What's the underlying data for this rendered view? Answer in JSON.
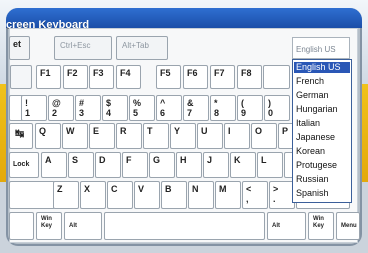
{
  "window": {
    "title": "creen Keyboard"
  },
  "toolbar": {
    "partial_label": "et",
    "ctrl_esc": "Ctrl+Esc",
    "alt_tab": "Alt+Tab"
  },
  "language": {
    "selected": "English US",
    "options": [
      "English US",
      "French",
      "German",
      "Hungarian",
      "Italian",
      "Japanese",
      "Korean",
      "Protugese",
      "Russian",
      "Spanish"
    ]
  },
  "rows": {
    "fkeys": [
      "F1",
      "F2",
      "F3",
      "F4",
      "F5",
      "F6",
      "F7",
      "F8"
    ],
    "numbers": [
      {
        "shift": "!",
        "base": "1"
      },
      {
        "shift": "@",
        "base": "2"
      },
      {
        "shift": "#",
        "base": "3"
      },
      {
        "shift": "$",
        "base": "4"
      },
      {
        "shift": "%",
        "base": "5"
      },
      {
        "shift": "^",
        "base": "6"
      },
      {
        "shift": "&",
        "base": "7"
      },
      {
        "shift": "*",
        "base": "8"
      },
      {
        "shift": "(",
        "base": "9"
      },
      {
        "shift": ")",
        "base": "0"
      }
    ],
    "qwerty": [
      "Q",
      "W",
      "E",
      "R",
      "T",
      "Y",
      "U",
      "I",
      "O",
      "P"
    ],
    "home": [
      "A",
      "S",
      "D",
      "F",
      "G",
      "H",
      "J",
      "K",
      "L"
    ],
    "bottom": [
      "Z",
      "X",
      "C",
      "V",
      "B",
      "N",
      "M"
    ],
    "bottom_punct": [
      {
        "shift": "<",
        "base": ","
      },
      {
        "shift": ">",
        "base": "."
      }
    ]
  },
  "special": {
    "tab_glyph": "↹",
    "caps_label": "Lock",
    "win_key": "Win Key",
    "alt": "Alt",
    "alt_right": "Alt",
    "win_key_right": "Win Key",
    "menu": "Menu"
  },
  "colors": {
    "title_bar": "#1f55b3",
    "selection": "#2a57b6",
    "accent_yellow": "#f0c21a"
  }
}
